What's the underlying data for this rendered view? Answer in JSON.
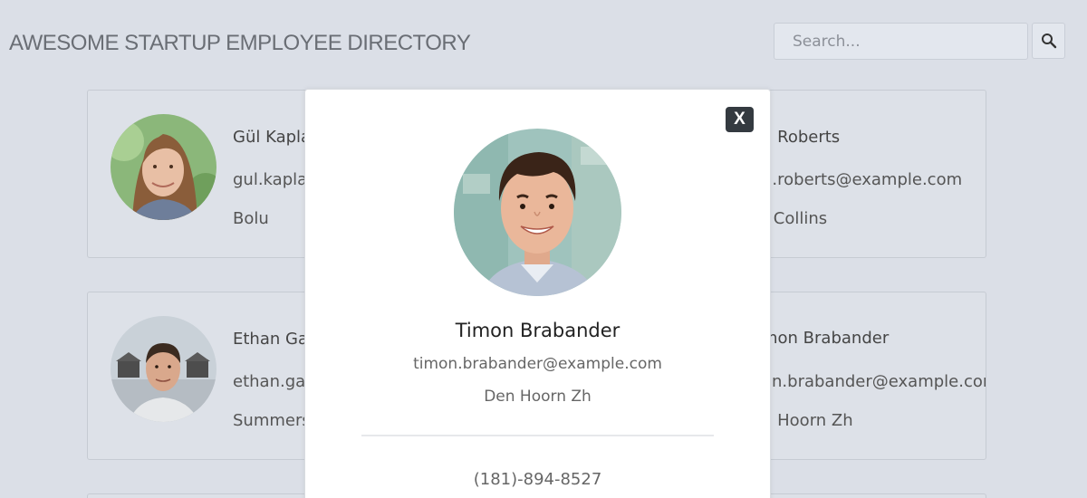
{
  "header": {
    "title": "AWESOME STARTUP EMPLOYEE DIRECTORY",
    "search_placeholder": "Search..."
  },
  "cards": [
    {
      "name": "Gül Kapla",
      "email": "gul.kapla",
      "city": "Bolu"
    },
    {
      "name": "n Roberts",
      "email": "n.roberts@example.com",
      "city": "t Collins"
    },
    {
      "name": "Ethan Ga",
      "email": "ethan.gau",
      "city": "Summers"
    },
    {
      "name": "mon Brabander",
      "email": "on.brabander@example.cor",
      "city": "n Hoorn Zh"
    }
  ],
  "modal": {
    "close_label": "X",
    "name": "Timon Brabander",
    "email": "timon.brabander@example.com",
    "city": "Den Hoorn Zh",
    "phone": "(181)-894-8527"
  }
}
